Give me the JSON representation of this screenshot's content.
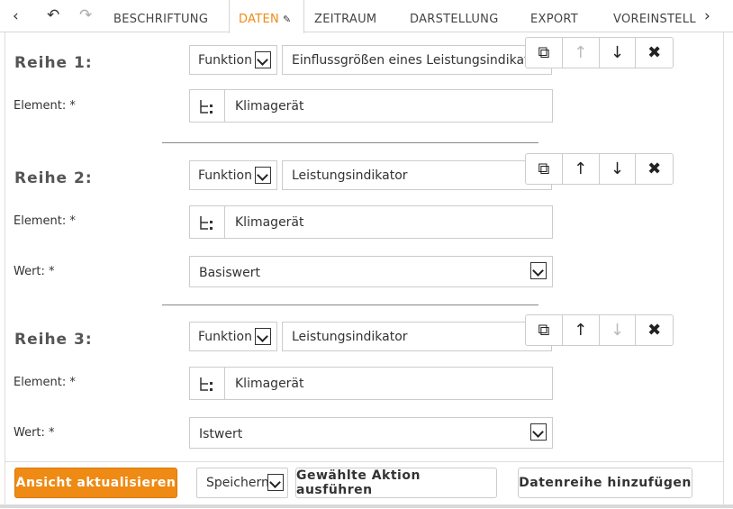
{
  "tabs": {
    "nav_left": "‹",
    "undo": "↶",
    "redo": "↷",
    "nav_right": "›",
    "items": [
      "BESCHRIFTUNG",
      "DATEN",
      "ZEITRAUM",
      "DARSTELLUNG",
      "EXPORT",
      "VOREINSTELL"
    ],
    "active_index": 1,
    "active_edit_icon": "pencil-icon"
  },
  "rows": [
    {
      "title": "Reihe 1:",
      "function_label": "Funktion",
      "function_value": "Einflussgrößen eines Leistungsindikators",
      "element_label": "Element: *",
      "element_value": "Klimagerät",
      "up_enabled": false,
      "down_enabled": true
    },
    {
      "title": "Reihe 2:",
      "function_label": "Funktion",
      "function_value": "Leistungsindikator",
      "element_label": "Element: *",
      "element_value": "Klimagerät",
      "wert_label": "Wert: *",
      "wert_value": "Basiswert",
      "up_enabled": true,
      "down_enabled": true
    },
    {
      "title": "Reihe 3:",
      "function_label": "Funktion",
      "function_value": "Leistungsindikator",
      "element_label": "Element: *",
      "element_value": "Klimagerät",
      "wert_label": "Wert: *",
      "wert_value": "Istwert",
      "up_enabled": true,
      "down_enabled": false
    }
  ],
  "actions": {
    "copy_icon": "copy-icon",
    "up_icon": "arrow-up-icon",
    "down_icon": "arrow-down-icon",
    "delete_icon": "close-icon"
  },
  "footer": {
    "refresh_label": "Ansicht aktualisieren",
    "save_select_value": "Speichern",
    "execute_label": "Gewählte Aktion ausführen",
    "add_series_label": "Datenreihe hinzufügen"
  },
  "colors": {
    "accent": "#ef8a14"
  }
}
